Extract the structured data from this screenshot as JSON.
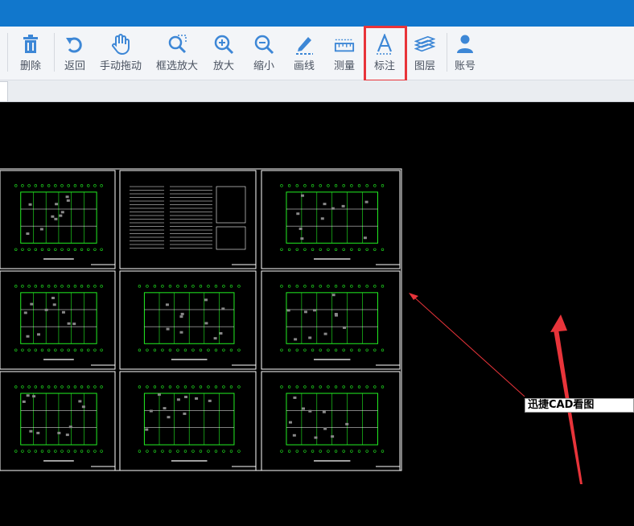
{
  "toolbar": {
    "items": [
      {
        "id": "delete",
        "label": "删除",
        "icon": "trash-icon"
      },
      {
        "id": "back",
        "label": "返回",
        "icon": "undo-icon"
      },
      {
        "id": "pan",
        "label": "手动拖动",
        "icon": "hand-icon"
      },
      {
        "id": "zoom-box",
        "label": "框选放大",
        "icon": "zoom-box-icon"
      },
      {
        "id": "zoom-in",
        "label": "放大",
        "icon": "zoom-in-icon"
      },
      {
        "id": "zoom-out",
        "label": "缩小",
        "icon": "zoom-out-icon"
      },
      {
        "id": "draw-line",
        "label": "画线",
        "icon": "pencil-icon"
      },
      {
        "id": "measure",
        "label": "测量",
        "icon": "ruler-icon"
      },
      {
        "id": "annotate",
        "label": "标注",
        "icon": "text-a-icon",
        "highlighted": true
      },
      {
        "id": "layers",
        "label": "图层",
        "icon": "layers-icon"
      },
      {
        "id": "account",
        "label": "账号",
        "icon": "user-icon"
      }
    ]
  },
  "canvas": {
    "annotation_text": "迅捷CAD看图",
    "background": "#000000",
    "drawing_color": "#22ee22",
    "frame_color": "#ffffff"
  },
  "colors": {
    "titlebar": "#1177cc",
    "toolbar_bg": "#f3f5f8",
    "icon": "#3d87d6",
    "highlight": "#e8343a",
    "arrow": "#e8343a"
  }
}
